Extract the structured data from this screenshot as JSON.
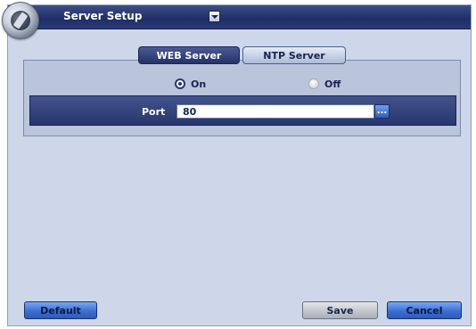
{
  "window": {
    "title": "Server Setup"
  },
  "tabs": [
    {
      "label": "WEB Server",
      "active": true
    },
    {
      "label": "NTP Server",
      "active": false
    }
  ],
  "server_state": {
    "on_label": "On",
    "off_label": "Off",
    "selected": "On"
  },
  "port": {
    "label": "Port",
    "value": "80",
    "more_label": "..."
  },
  "buttons": {
    "default_label": "Default",
    "save_label": "Save",
    "cancel_label": "Cancel"
  },
  "colors": {
    "window_bg": "#cdd7e9",
    "titlebar": "#1f2e66",
    "accent_blue": "#3c6fd0",
    "panel_bar": "#28366e"
  },
  "icons": {
    "app_logo": "app-logo-icon",
    "title_dropdown": "chevron-down-icon",
    "more": "ellipsis-icon"
  }
}
